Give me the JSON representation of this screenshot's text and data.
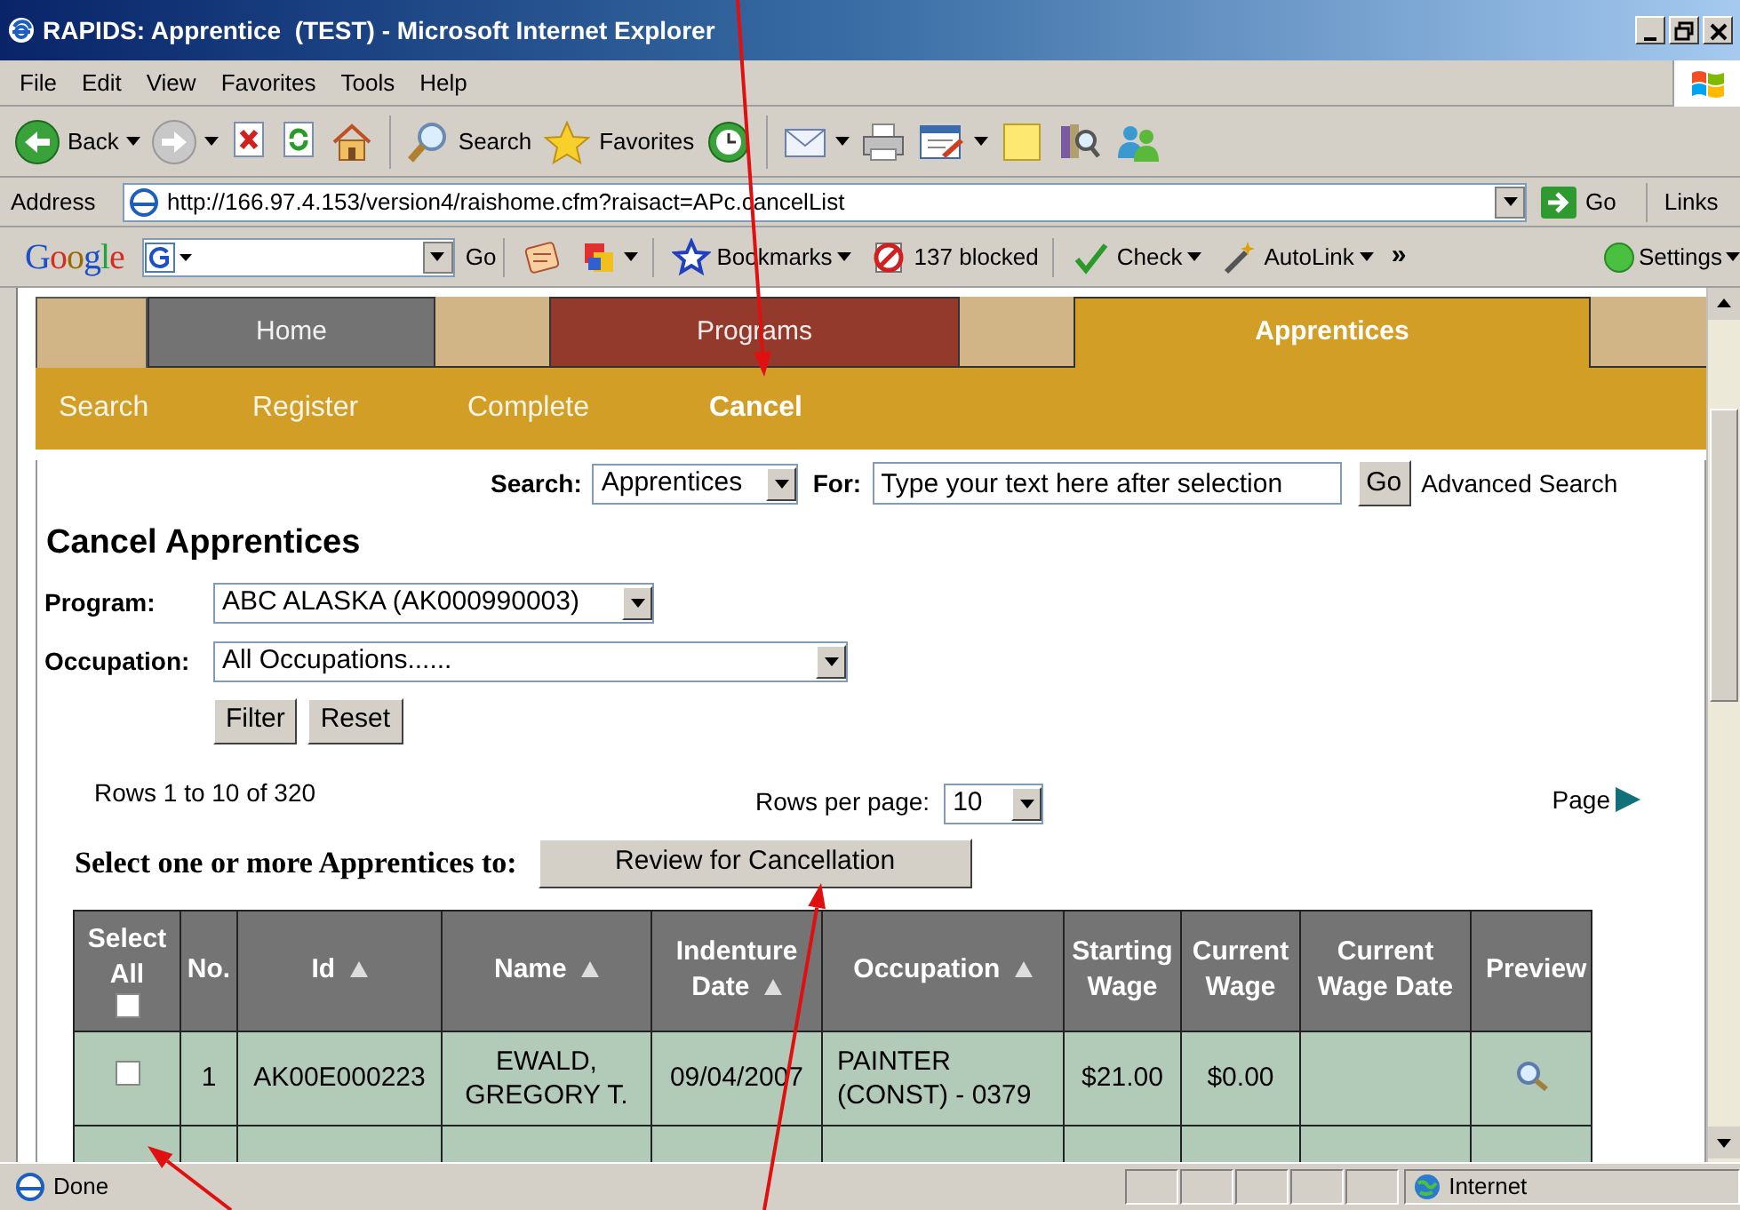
{
  "window": {
    "title": "RAPIDS: Apprentice  (TEST) - Microsoft Internet Explorer"
  },
  "menu": [
    "File",
    "Edit",
    "View",
    "Favorites",
    "Tools",
    "Help"
  ],
  "toolbar": [
    {
      "kind": "back",
      "label": "Back",
      "dropdown": true
    },
    {
      "kind": "forward",
      "dropdown": true
    },
    {
      "kind": "stop"
    },
    {
      "kind": "refresh"
    },
    {
      "kind": "home"
    },
    {
      "kind": "separator"
    },
    {
      "kind": "search",
      "label": "Search"
    },
    {
      "kind": "favorites",
      "label": "Favorites"
    },
    {
      "kind": "history"
    },
    {
      "kind": "separator"
    },
    {
      "kind": "mail",
      "dropdown": true
    },
    {
      "kind": "print"
    },
    {
      "kind": "edit",
      "dropdown": true
    },
    {
      "kind": "note"
    },
    {
      "kind": "research"
    },
    {
      "kind": "messenger"
    }
  ],
  "address_bar": {
    "label": "Address",
    "url": "http://166.97.4.153/version4/raishome.cfm?raisact=APc.cancelList",
    "go": "Go",
    "links": "Links"
  },
  "google_bar": {
    "logo": "Google",
    "go": "Go",
    "items": [
      {
        "kind": "highlight"
      },
      {
        "kind": "popup",
        "dropdown": true
      },
      {
        "kind": "bookmarks",
        "label": "Bookmarks",
        "dropdown": true
      },
      {
        "kind": "blocked",
        "label": "137 blocked"
      },
      {
        "kind": "check",
        "label": "Check",
        "dropdown": true
      },
      {
        "kind": "autolink",
        "label": "AutoLink",
        "dropdown": true
      }
    ],
    "more": "»",
    "settings": "Settings"
  },
  "tabs": [
    {
      "label": "Home",
      "selected": false,
      "color": "#737373"
    },
    {
      "label": "Programs",
      "selected": false,
      "color": "#933a2c"
    },
    {
      "label": "Apprentices",
      "selected": true,
      "color": "#d39e26"
    }
  ],
  "subnav": [
    {
      "label": "Search",
      "selected": false
    },
    {
      "label": "Register",
      "selected": false
    },
    {
      "label": "Complete",
      "selected": false
    },
    {
      "label": "Cancel",
      "selected": true
    }
  ],
  "search": {
    "label": "Search:",
    "scope": "Apprentices",
    "for_label": "For:",
    "value": "Type your text here after selection",
    "go": "Go",
    "advanced": "Advanced Search"
  },
  "page_title": "Cancel Apprentices",
  "filters": [
    {
      "label": "Program:",
      "value": "ABC ALASKA (AK000990003)",
      "wide": false
    },
    {
      "label": "Occupation:",
      "value": "All Occupations......",
      "wide": true
    }
  ],
  "filter_buttons": [
    "Filter",
    "Reset"
  ],
  "pager": {
    "summary": "Rows 1 to 10 of 320",
    "rows_label": "Rows per page:",
    "rows_value": "10",
    "page_label": "Page"
  },
  "action": {
    "prompt": "Select one or more Apprentices to:",
    "button": "Review for Cancellation"
  },
  "table": {
    "columns": [
      {
        "label": "Select All",
        "kind": "select_all",
        "checked": false
      },
      {
        "label": "No."
      },
      {
        "label": "Id",
        "sortable": true
      },
      {
        "label": "Name",
        "sortable": true
      },
      {
        "label": "Indenture Date",
        "sortable": true
      },
      {
        "label": "Occupation",
        "sortable": true
      },
      {
        "label": "Starting Wage"
      },
      {
        "label": "Current Wage"
      },
      {
        "label": "Current Wage Date"
      },
      {
        "label": "Preview"
      }
    ],
    "rows": [
      {
        "checked": false,
        "no": "1",
        "id": "AK00E000223",
        "name": "EWALD, GREGORY T.",
        "indenture_date": "09/04/2007",
        "occupation": "PAINTER (CONST) - 0379",
        "starting_wage": "$21.00",
        "current_wage": "$0.00"
      }
    ]
  },
  "status_bar": {
    "text": "Done",
    "zone": "Internet"
  }
}
